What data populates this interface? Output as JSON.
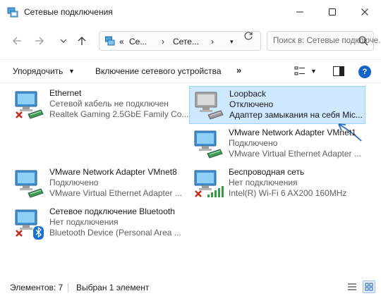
{
  "window": {
    "title": "Сетевые подключения",
    "minimize_icon": "minimize-icon",
    "maximize_icon": "maximize-icon",
    "close_icon": "close-icon"
  },
  "navigation": {
    "back_icon": "arrow-left-icon",
    "forward_icon": "arrow-right-icon",
    "recent_icon": "chevron-down-icon",
    "up_icon": "arrow-up-icon",
    "address_prefix": "«",
    "breadcrumb": [
      "Се...",
      "Сете..."
    ],
    "refresh_icon": "refresh-icon",
    "search_placeholder": "Поиск в: Сетевые подключе..."
  },
  "toolbar": {
    "organize_label": "Упорядочить",
    "enable_label": "Включение сетевого устройства",
    "more_label": "»",
    "help_label": "?"
  },
  "connections": [
    {
      "name": "Ethernet",
      "status": "Сетевой кабель не подключен",
      "device": "Realtek Gaming 2.5GbE Family Co...",
      "badge": "red-x",
      "selected": false
    },
    {
      "name": "Loopback",
      "status": "Отключено",
      "device": "Адаптер замыкания на себя Mic...",
      "badge": "disabled",
      "selected": true
    },
    {
      "name": "VMware Network Adapter VMnet1",
      "status": "Подключено",
      "device": "VMware Virtual Ethernet Adapter ...",
      "badge": "none",
      "selected": false
    },
    {
      "name": "VMware Network Adapter VMnet8",
      "status": "Подключено",
      "device": "VMware Virtual Ethernet Adapter ...",
      "badge": "none",
      "selected": false
    },
    {
      "name": "Беспроводная сеть",
      "status": "Нет подключения",
      "device": "Intel(R) Wi-Fi 6 AX200 160MHz",
      "badge": "red-x-wifi",
      "selected": false
    },
    {
      "name": "Сетевое подключение Bluetooth",
      "status": "Нет подключения",
      "device": "Bluetooth Device (Personal Area ...",
      "badge": "red-x-bluetooth",
      "selected": false
    }
  ],
  "statusbar": {
    "count": "Элементов: 7",
    "selected": "Выбран 1 элемент"
  },
  "colors": {
    "selection_bg": "#cde8ff",
    "selection_border": "#99d1ff",
    "accent": "#1463c8",
    "error": "#c42b1c",
    "arrow_annotation": "#2a6fbd"
  }
}
